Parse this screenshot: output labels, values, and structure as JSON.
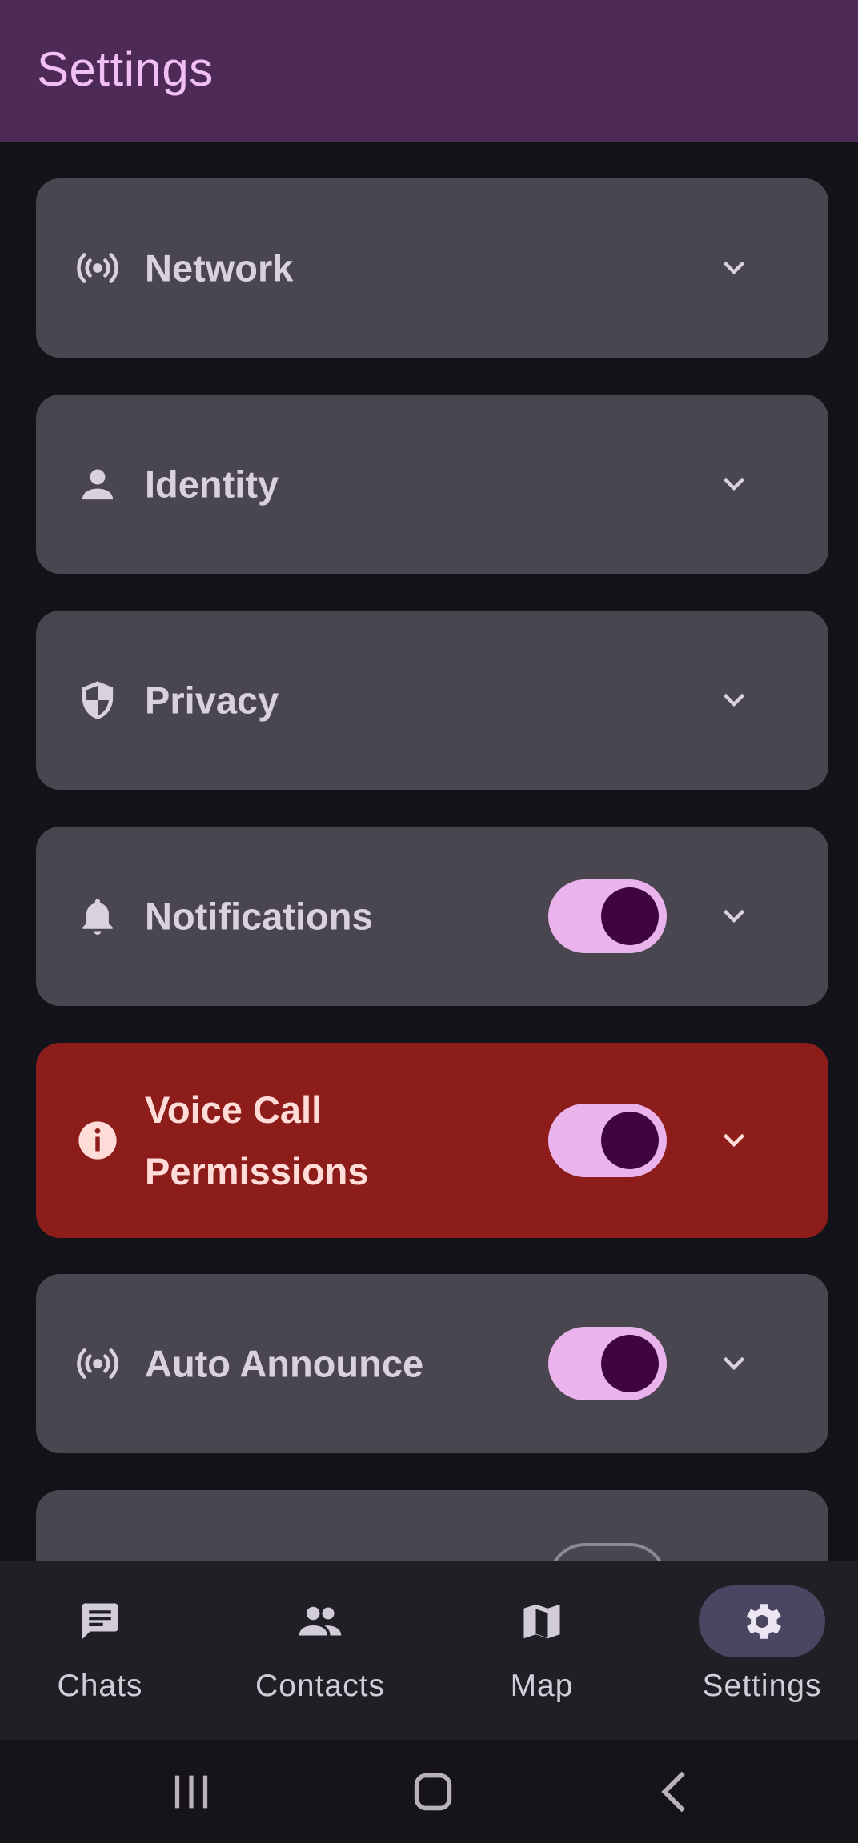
{
  "header": {
    "title": "Settings"
  },
  "settings": [
    {
      "label": "Network",
      "icon": "broadcast-icon",
      "toggle": null
    },
    {
      "label": "Identity",
      "icon": "person-icon",
      "toggle": null
    },
    {
      "label": "Privacy",
      "icon": "shield-icon",
      "toggle": null
    },
    {
      "label": "Notifications",
      "icon": "bell-icon",
      "toggle": "on"
    },
    {
      "label": "Voice Call Permissions",
      "icon": "info-icon",
      "toggle": "on",
      "highlight": "#8c1d1b"
    },
    {
      "label": "Auto Announce",
      "icon": "broadcast-icon",
      "toggle": "on"
    },
    {
      "label": "",
      "icon": "person-icon",
      "toggle": "off"
    }
  ],
  "nav": {
    "items": [
      {
        "label": "Chats",
        "icon": "chat-icon",
        "active": false
      },
      {
        "label": "Contacts",
        "icon": "contacts-icon",
        "active": false
      },
      {
        "label": "Map",
        "icon": "map-icon",
        "active": false
      },
      {
        "label": "Settings",
        "icon": "gear-icon",
        "active": true
      }
    ]
  },
  "system_nav": [
    "recents-icon",
    "home-icon",
    "back-icon"
  ],
  "colors": {
    "accent": "#ebb3ec",
    "header": "#4e2a56",
    "alert": "#8c1d1b",
    "card": "#4a4650"
  }
}
